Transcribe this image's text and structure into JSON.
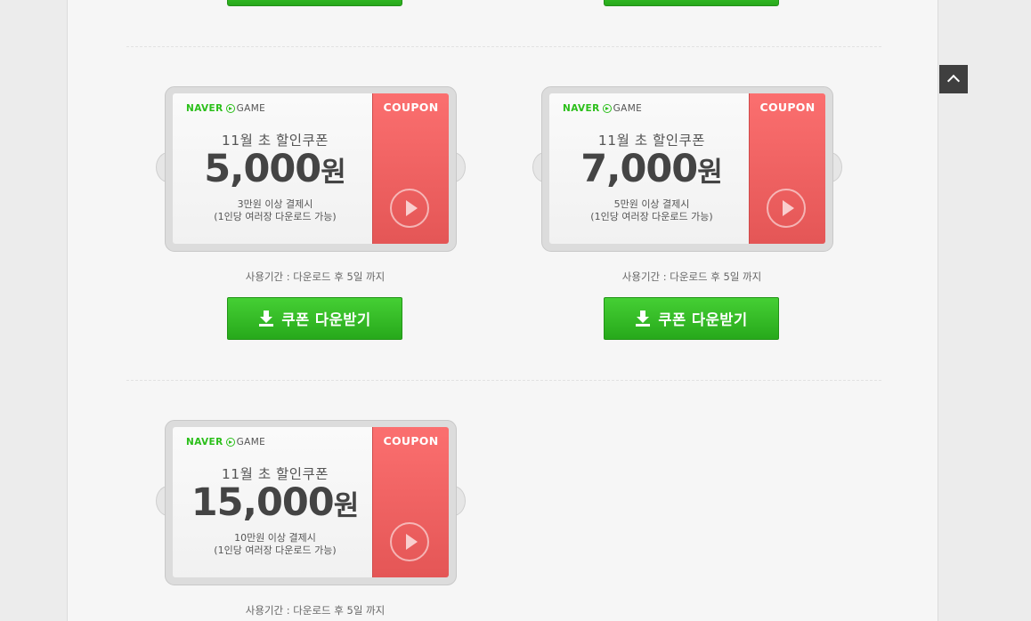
{
  "coupons": [
    {
      "brand_naver": "NAVER",
      "brand_game": "GAME",
      "stub_label": "COUPON",
      "title": "11월 초 할인쿠폰",
      "amount": "5,000",
      "unit": "원",
      "condition": "3만원 이상 결제시",
      "note": "(1인당 여러장 다운로드 가능)",
      "period": "사용기간 : 다운로드 후 5일 까지",
      "button_label": "쿠폰 다운받기"
    },
    {
      "brand_naver": "NAVER",
      "brand_game": "GAME",
      "stub_label": "COUPON",
      "title": "11월 초 할인쿠폰",
      "amount": "7,000",
      "unit": "원",
      "condition": "5만원 이상 결제시",
      "note": "(1인당 여러장 다운로드 가능)",
      "period": "사용기간 : 다운로드 후 5일 까지",
      "button_label": "쿠폰 다운받기"
    },
    {
      "brand_naver": "NAVER",
      "brand_game": "GAME",
      "stub_label": "COUPON",
      "title": "11월 초 할인쿠폰",
      "amount": "15,000",
      "unit": "원",
      "condition": "10만원 이상 결제시",
      "note": "(1인당 여러장 다운로드 가능)",
      "period": "사용기간 : 다운로드 후 5일 까지"
    }
  ],
  "icons": {
    "scroll_top": "chevron-up-icon",
    "download": "download-icon",
    "play": "play-circle-icon",
    "brand": "naver-game-play-icon"
  },
  "colors": {
    "accent_green": "#2bbf1a",
    "coupon_red": "#f26464",
    "button_green": "#36bc27"
  }
}
